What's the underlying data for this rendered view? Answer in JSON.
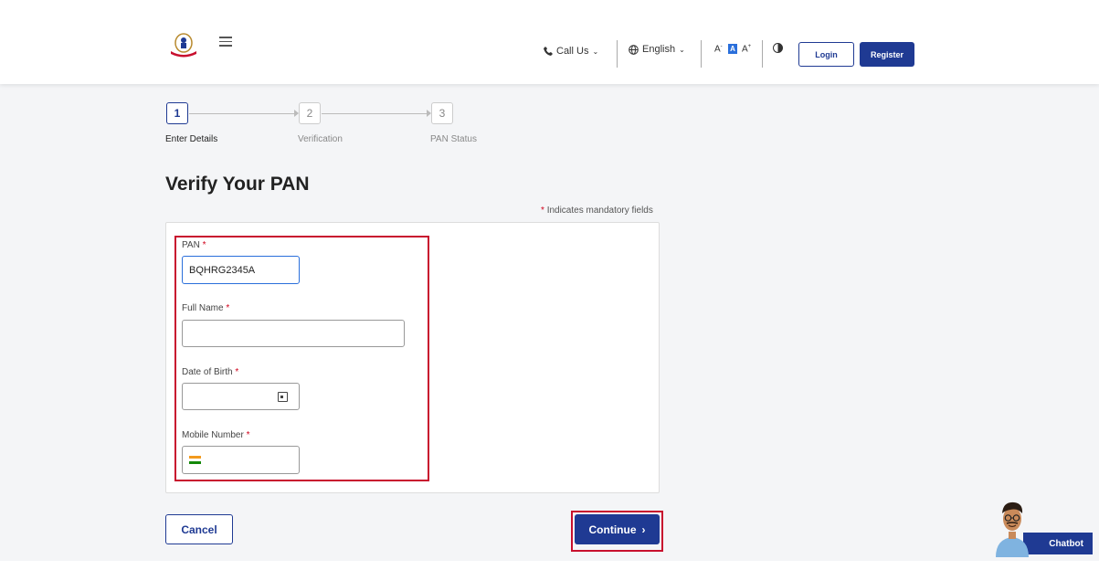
{
  "header": {
    "call_us": "Call Us",
    "language": "English",
    "font_small": "A",
    "font_normal": "A",
    "font_large": "A",
    "login": "Login",
    "register": "Register"
  },
  "stepper": {
    "steps": [
      {
        "number": "1",
        "label": "Enter Details"
      },
      {
        "number": "2",
        "label": "Verification"
      },
      {
        "number": "3",
        "label": "PAN Status"
      }
    ]
  },
  "page": {
    "title": "Verify Your PAN",
    "mandatory_star": "*",
    "mandatory_note": "Indicates mandatory fields"
  },
  "form": {
    "pan_label": "PAN",
    "pan_value": "BQHRG2345A",
    "full_name_label": "Full Name",
    "full_name_value": "",
    "dob_label": "Date of Birth",
    "dob_value": "",
    "mobile_label": "Mobile Number",
    "mobile_value": "",
    "required_mark": "*"
  },
  "actions": {
    "cancel": "Cancel",
    "continue": "Continue"
  },
  "chatbot": {
    "label": "Chatbot"
  },
  "colors": {
    "primary": "#1f3a93",
    "highlight": "#c8102e",
    "required": "#d0021b"
  }
}
